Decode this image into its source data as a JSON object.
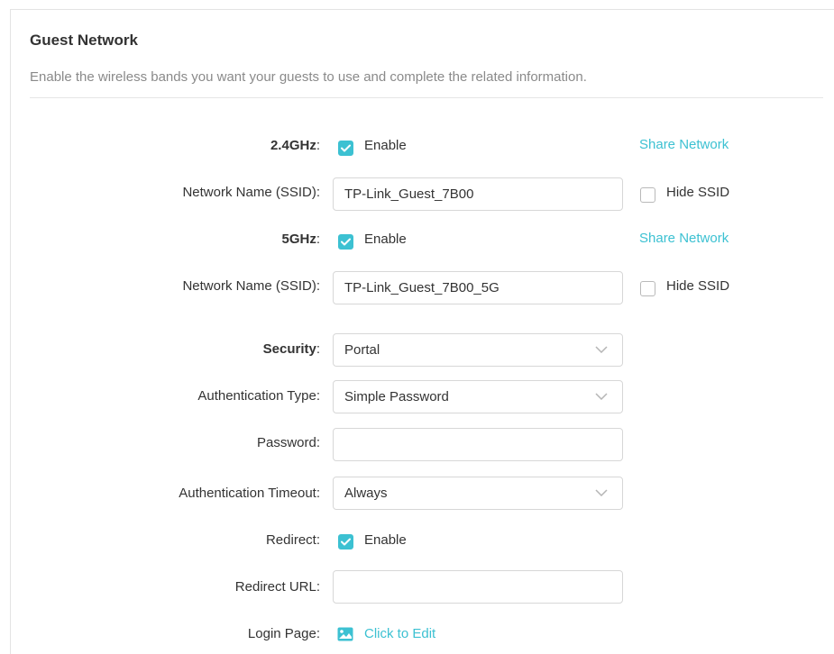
{
  "section": {
    "title": "Guest Network",
    "description": "Enable the wireless bands you want your guests to use and complete the related information."
  },
  "band24": {
    "label": "2.4GHz",
    "colon": ":",
    "enable_label": "Enable",
    "enabled": true,
    "share_label": "Share Network",
    "ssid_label": "Network Name (SSID):",
    "ssid_value": "TP-Link_Guest_7B00",
    "hide_ssid_label": "Hide SSID",
    "hide_ssid": false
  },
  "band5": {
    "label": "5GHz",
    "colon": ":",
    "enable_label": "Enable",
    "enabled": true,
    "share_label": "Share Network",
    "ssid_label": "Network Name (SSID):",
    "ssid_value": "TP-Link_Guest_7B00_5G",
    "hide_ssid_label": "Hide SSID",
    "hide_ssid": false
  },
  "security": {
    "label": "Security",
    "colon": ":",
    "value": "Portal"
  },
  "auth_type": {
    "label": "Authentication Type:",
    "value": "Simple Password"
  },
  "password": {
    "label": "Password:",
    "value": ""
  },
  "auth_timeout": {
    "label": "Authentication Timeout:",
    "value": "Always"
  },
  "redirect": {
    "label": "Redirect:",
    "enable_label": "Enable",
    "enabled": true
  },
  "redirect_url": {
    "label": "Redirect URL:",
    "value": ""
  },
  "login_page": {
    "label": "Login Page:",
    "edit_label": "Click to Edit",
    "icon": "image-edit-icon"
  },
  "colors": {
    "accent": "#3cc1d2",
    "text": "#333333",
    "muted": "#8a8a8a",
    "border": "#d7d7d7"
  }
}
